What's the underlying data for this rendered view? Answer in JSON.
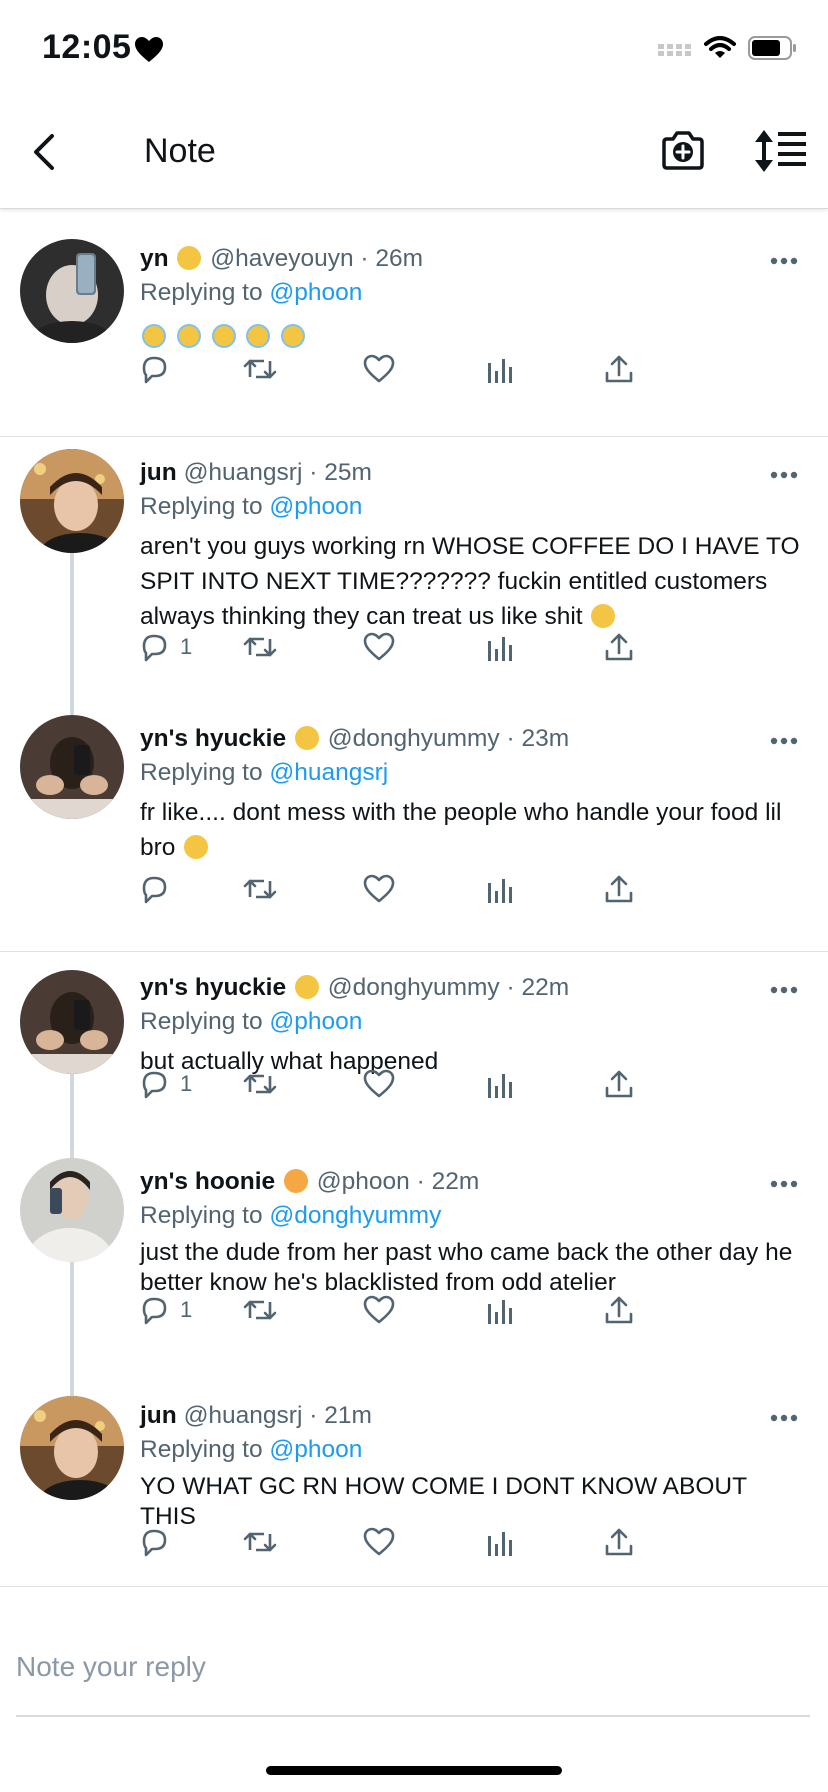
{
  "status": {
    "time": "12:05"
  },
  "header": {
    "title": "Note"
  },
  "tweets": [
    {
      "name": "yn",
      "handle": "@haveyouyn",
      "time": "26m",
      "replying_prefix": "Replying to",
      "replying_to": "@phoon",
      "body": "",
      "reply_count": "",
      "avatar_color": "#3a3a3a"
    },
    {
      "name": "jun",
      "handle": "@huangsrj",
      "time": "25m",
      "replying_prefix": "Replying to",
      "replying_to": "@phoon",
      "body": "aren't you guys working rn WHOSE COFFEE DO I HAVE TO SPIT INTO NEXT TIME??????? fuckin entitled customers always thinking they can treat us like shit",
      "reply_count": "1",
      "avatar_color": "#8a5a3a"
    },
    {
      "name": "yn's hyuckie",
      "handle": "@donghyummy",
      "time": "23m",
      "replying_prefix": "Replying to",
      "replying_to": "@huangsrj",
      "body": "fr like.... dont mess with the people who handle your food lil bro",
      "reply_count": "",
      "avatar_color": "#5a4a40"
    },
    {
      "name": "yn's hyuckie",
      "handle": "@donghyummy",
      "time": "22m",
      "replying_prefix": "Replying to",
      "replying_to": "@phoon",
      "body": "but actually what happened",
      "reply_count": "1",
      "avatar_color": "#5a4a40"
    },
    {
      "name": "yn's hoonie",
      "handle": "@phoon",
      "time": "22m",
      "replying_prefix": "Replying to",
      "replying_to": "@donghyummy",
      "body": "just the dude from her past who came back the other day he better know he's blacklisted from odd atelier",
      "reply_count": "1",
      "avatar_color": "#c9c9c5"
    },
    {
      "name": "jun",
      "handle": "@huangsrj",
      "time": "21m",
      "replying_prefix": "Replying to",
      "replying_to": "@phoon",
      "body": "YO WHAT GC RN HOW COME I DONT KNOW ABOUT THIS",
      "reply_count": "",
      "avatar_color": "#8a5a3a"
    }
  ],
  "reply_input": {
    "placeholder": "Note your reply"
  },
  "colors": {
    "accent": "#1d9bf0",
    "muted": "#536471",
    "thread_line": "#cfd9de"
  },
  "icons": [
    "heart-icon",
    "signal-icon",
    "wifi-icon",
    "battery-icon",
    "back-arrow-icon",
    "camera-plus-icon",
    "sort-icon",
    "more-icon",
    "reply-icon",
    "retweet-icon",
    "like-icon",
    "analytics-icon",
    "share-icon"
  ]
}
